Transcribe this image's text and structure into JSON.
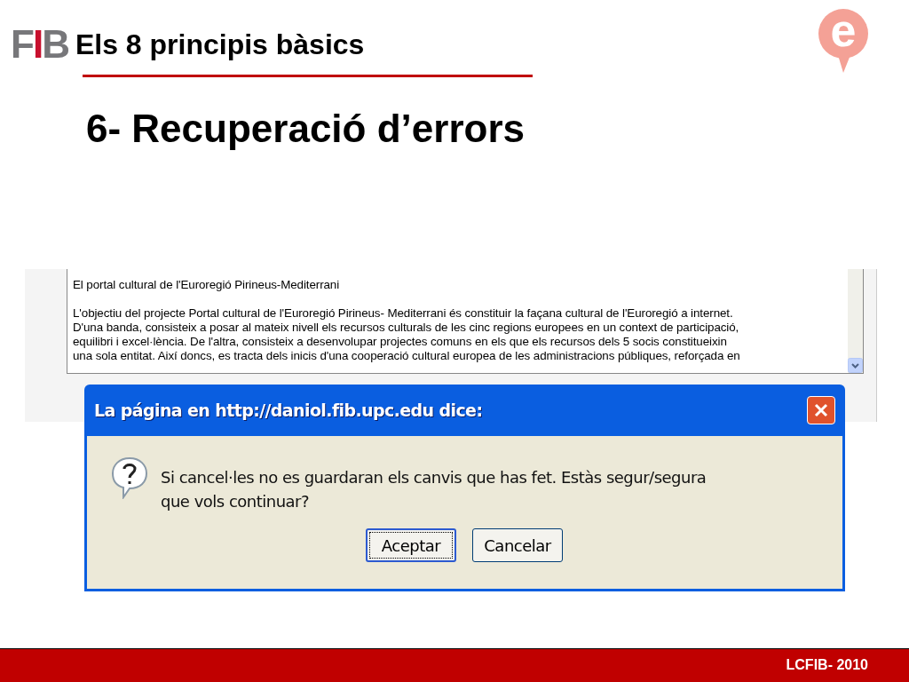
{
  "header": {
    "logo": "FIB",
    "title": "Els 8 principis bàsics",
    "badge": "e"
  },
  "heading": "6- Recuperació d’errors",
  "text_area": {
    "paragraphs": [
      [
        "El portal cultural de l'Euroregió Pirineus-Mediterrani"
      ],
      [
        "L'objectiu del projecte Portal cultural de l'Euroregió Pirineus- Mediterrani és constituir la façana cultural de l'Euroregió a internet.",
        "D'una banda, consisteix a posar al mateix nivell els recursos culturals de les cinc regions europees en un context de participació,",
        "equilibri i excel·lència. De l'altra, consisteix a desenvolupar projectes comuns en els que els recursos dels 5 socis constitueixin",
        "una sola entitat. Així doncs, es tracta dels inicis d'una cooperació cultural europea de les administracions públiques, reforçada en"
      ]
    ]
  },
  "dialog": {
    "title": "La página en http://daniol.fib.upc.edu dice:",
    "message": [
      "Si cancel·les no es guardaran els canvis que has fet. Estàs segur/segura",
      "que vols continuar?"
    ],
    "buttons": [
      {
        "label": "Aceptar",
        "focused": true
      },
      {
        "label": "Cancelar",
        "focused": false
      }
    ]
  },
  "footer": "LCFIB- 2010"
}
